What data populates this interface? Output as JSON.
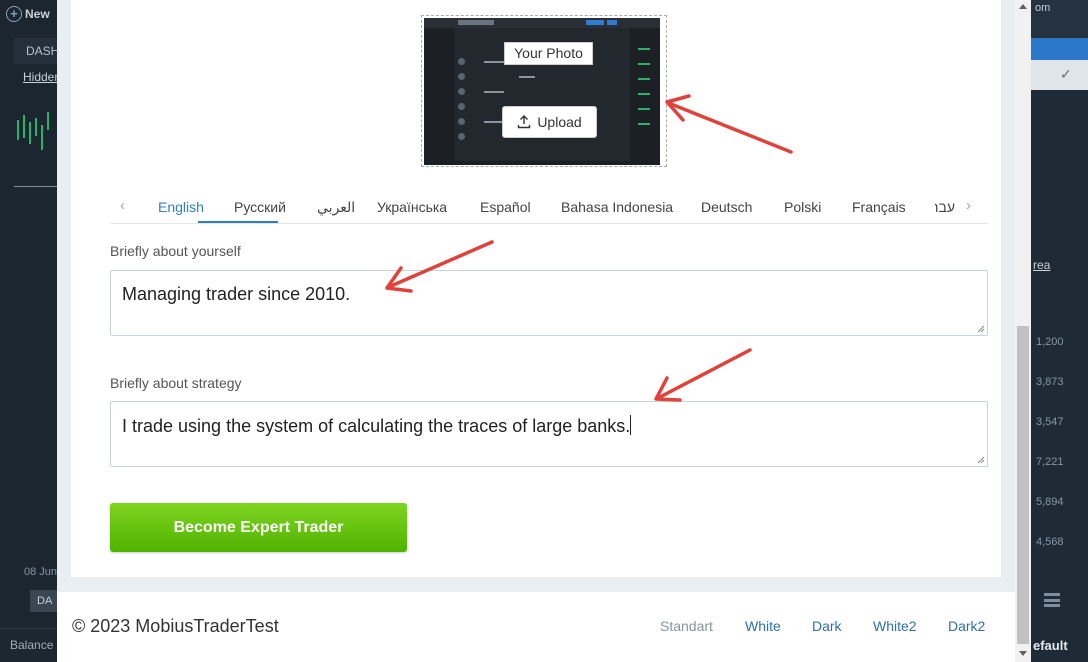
{
  "background_app": {
    "new_button": "New",
    "dashboard_tab": "DASH",
    "hidden_link": "Hidden",
    "date_label": "08 Jun",
    "da_button": "DA",
    "balance_label": "Balance",
    "right_top_text": "om",
    "area_link": "rea",
    "right_numbers": [
      "1,200",
      "3,873",
      "3,547",
      "7,221",
      "5,894",
      "4,568"
    ],
    "default_label": "efault"
  },
  "upload": {
    "photo_label": "Your Photo",
    "upload_label": "Upload",
    "upload_icon": "upload-icon"
  },
  "languages": {
    "prev_arrow": "‹",
    "next_arrow": "›",
    "items": [
      "English",
      "Русский",
      "العربي",
      "Українська",
      "Español",
      "Bahasa Indonesia",
      "Deutsch",
      "Polski",
      "Français",
      "עברית"
    ],
    "active": "English"
  },
  "about_yourself": {
    "label": "Briefly about yourself",
    "value": "Managing trader since 2010."
  },
  "about_strategy": {
    "label": "Briefly about strategy",
    "value": "I trade using the system of calculating the traces of large banks."
  },
  "cta": {
    "label": "Become Expert Trader",
    "color": "#5cbd0a"
  },
  "footer": {
    "copyright": "© 2023 MobiusTraderTest",
    "themes": [
      "Standart",
      "White",
      "Dark",
      "White2",
      "Dark2"
    ],
    "current_theme": "Standart"
  },
  "colors": {
    "accent": "#2f7fbf",
    "annotation_arrow": "#e0423a"
  }
}
